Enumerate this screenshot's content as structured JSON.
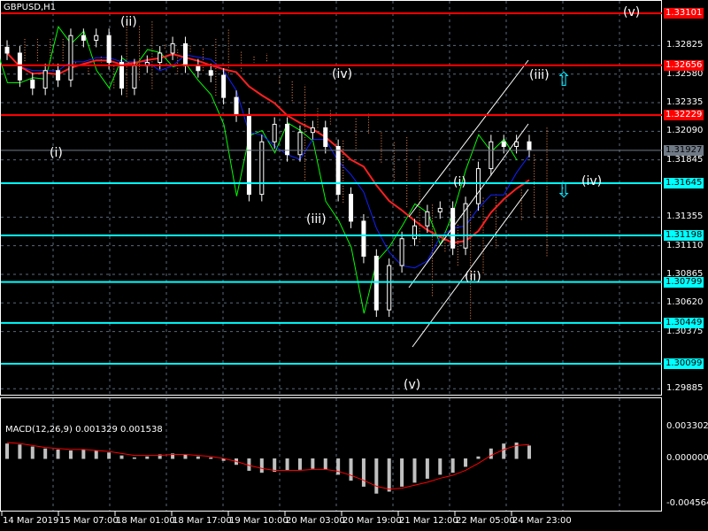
{
  "title": "GBPUSD,H1",
  "macd_label": "MACD(12,26,9) 0.001329 0.001538",
  "colors": {
    "resistance": "#ff0000",
    "support": "#00ffff",
    "current": "#707a86",
    "candle": "#ffffff",
    "ma": "#ff2020",
    "chikou": "#00ff00",
    "kijun": "#1020ff",
    "cloud": "#ff9050",
    "macd_hist": "#c0c0c0",
    "macd_signal": "#ff0000"
  },
  "chart_data": {
    "type": "candlestick",
    "symbol": "GBPUSD",
    "timeframe": "H1",
    "ylim": [
      1.297,
      1.3322
    ],
    "price_ticks": [
      "1.32825",
      "1.32580",
      "1.32335",
      "1.32090",
      "1.31845",
      "1.31355",
      "1.31110",
      "1.30865",
      "1.30620",
      "1.30375",
      "1.29885"
    ],
    "time_ticks": [
      "14 Mar 2019",
      "15 Mar 07:00",
      "18 Mar 01:00",
      "18 Mar 17:00",
      "19 Mar 10:00",
      "20 Mar 03:00",
      "20 Mar 19:00",
      "21 Mar 12:00",
      "22 Mar 05:00",
      "24 Mar 23:00"
    ],
    "closes": [
      1.3276,
      1.3253,
      1.3246,
      1.3261,
      1.3253,
      1.3291,
      1.3287,
      1.3291,
      1.3268,
      1.3246,
      1.3265,
      1.3268,
      1.3276,
      1.3284,
      1.3265,
      1.3261,
      1.3257,
      1.3238,
      1.3223,
      1.3155,
      1.32,
      1.3215,
      1.3189,
      1.3208,
      1.3212,
      1.3196,
      1.3155,
      1.3132,
      1.3102,
      1.3056,
      1.3094,
      1.3117,
      1.3128,
      1.314,
      1.3143,
      1.3109,
      1.3147,
      1.3177,
      1.32,
      1.3196,
      1.32,
      1.31927
    ],
    "levels": [
      {
        "price": "1.33101",
        "type": "resistance"
      },
      {
        "price": "1.32656",
        "type": "resistance"
      },
      {
        "price": "1.32229",
        "type": "resistance"
      },
      {
        "price": "1.31927",
        "type": "current"
      },
      {
        "price": "1.31645",
        "type": "support"
      },
      {
        "price": "1.31198",
        "type": "support"
      },
      {
        "price": "1.30799",
        "type": "support"
      },
      {
        "price": "1.30449",
        "type": "support"
      },
      {
        "price": "1.30099",
        "type": "support"
      }
    ],
    "wave_labels": [
      "(v)",
      "(ii)",
      "(iii)",
      "(iv)",
      "(i)",
      "(iii)",
      "(i)",
      "(iv)",
      "(ii)",
      "(v)"
    ],
    "macd": {
      "ylim": [
        -0.004564,
        0.003302
      ],
      "ticks": [
        "0.003302",
        "0.000000",
        "-0.004564"
      ],
      "hist": [
        0.0015,
        0.0014,
        0.0012,
        0.001,
        0.0009,
        0.0008,
        0.0009,
        0.0008,
        0.0006,
        0.0003,
        0.0001,
        0.0002,
        0.0004,
        0.0005,
        0.0004,
        0.0002,
        0.0001,
        -0.0002,
        -0.0006,
        -0.0012,
        -0.0014,
        -0.0013,
        -0.0012,
        -0.0011,
        -0.001,
        -0.0011,
        -0.0016,
        -0.0022,
        -0.0028,
        -0.0035,
        -0.0033,
        -0.0028,
        -0.0024,
        -0.002,
        -0.0016,
        -0.0014,
        -0.0008,
        0.0002,
        0.001,
        0.0015,
        0.0016,
        0.0013
      ],
      "signal": [
        0.0016,
        0.0015,
        0.0013,
        0.0011,
        0.001,
        0.0009,
        0.0009,
        0.0008,
        0.0007,
        0.0005,
        0.0003,
        0.0003,
        0.0003,
        0.0004,
        0.0004,
        0.0003,
        0.0002,
        0.0,
        -0.0003,
        -0.0007,
        -0.001,
        -0.0012,
        -0.0012,
        -0.0012,
        -0.0011,
        -0.0011,
        -0.0013,
        -0.0017,
        -0.0022,
        -0.0028,
        -0.0031,
        -0.003,
        -0.0027,
        -0.0024,
        -0.002,
        -0.0017,
        -0.0012,
        -0.0005,
        0.0003,
        0.0009,
        0.0013,
        0.0014
      ]
    }
  }
}
